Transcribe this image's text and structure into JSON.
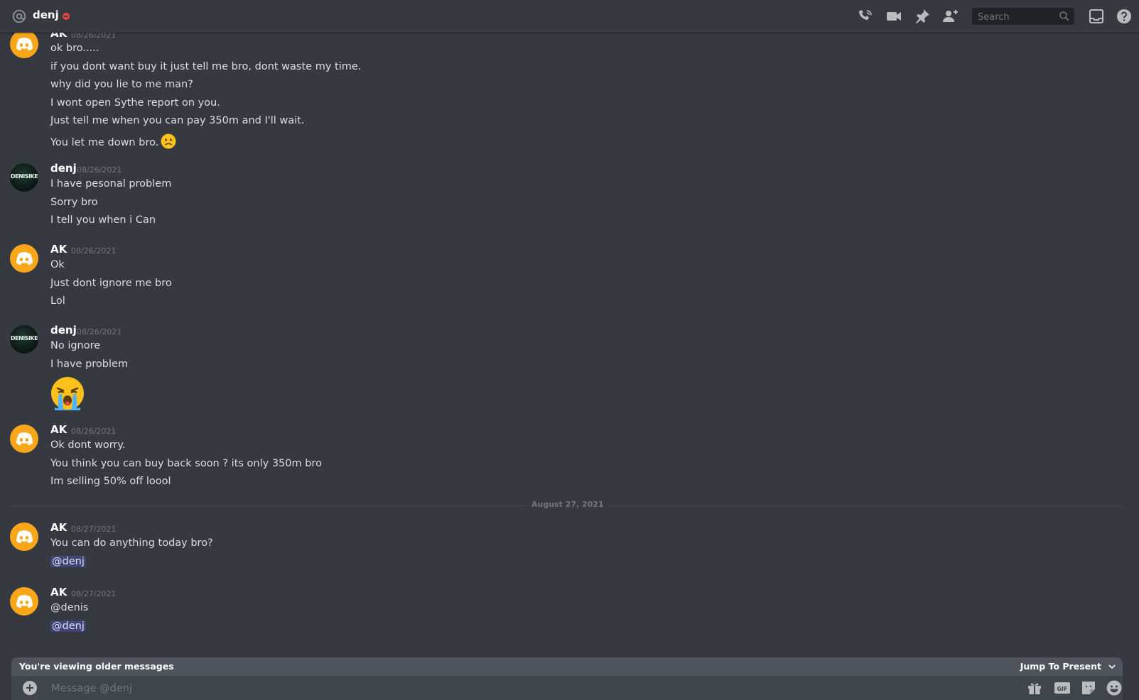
{
  "header": {
    "channel_type_icon": "at-sign-icon",
    "title": "denj",
    "status": "do-not-disturb",
    "search_placeholder": "Search",
    "icons": [
      "call-icon",
      "video-icon",
      "pin-icon",
      "add-friend-icon",
      "search-icon",
      "inbox-icon",
      "help-icon"
    ]
  },
  "messages": {
    "groups": [
      {
        "author": "AK",
        "timestamp": "08/26/2021",
        "avatar": "discord-default-orange",
        "lines": [
          "ok bro.....",
          "if you dont want buy it just tell me bro, dont waste my time.",
          "why did you lie to me man?",
          "I wont open Sythe report on you.",
          "Just tell me when you can pay 350m and I'll wait.",
          "You let me down bro."
        ]
      },
      {
        "author": "denj",
        "timestamp": "08/26/2021",
        "avatar": "DENISIKE",
        "lines": [
          "I have pesonal problem",
          "Sorry bro",
          "I tell you when i Can"
        ]
      },
      {
        "author": "AK",
        "timestamp": "08/26/2021",
        "avatar": "discord-default-orange",
        "lines": [
          "Ok",
          "Just dont ignore me bro",
          "Lol"
        ]
      },
      {
        "author": "denj",
        "timestamp": "08/26/2021",
        "avatar": "DENISIKE",
        "lines": [
          "No ignore",
          "I have problem"
        ]
      },
      {
        "author": "AK",
        "timestamp": "08/26/2021",
        "avatar": "discord-default-orange",
        "lines": [
          "Ok dont worry.",
          "You think you can buy back soon ? its only 350m bro",
          "Im selling 50% off loool"
        ]
      },
      {
        "author": "AK",
        "timestamp": "08/27/2021",
        "avatar": "discord-default-orange",
        "lines": [
          "You can do anything today bro?",
          "@denj"
        ]
      },
      {
        "author": "AK",
        "timestamp": "08/27/2021",
        "avatar": "discord-default-orange",
        "lines": [
          "@denis",
          "@denj"
        ]
      }
    ],
    "date_divider": "August 27, 2021",
    "emojis": [
      "frowning-face-emoji",
      "loudly-crying-face-emoji"
    ]
  },
  "older_bar": {
    "notice": "You're viewing older messages",
    "jump_label": "Jump To Present"
  },
  "composer": {
    "placeholder": "Message @denj",
    "icons": [
      "add-attachment-icon",
      "gift-icon",
      "gif-icon",
      "sticker-icon",
      "emoji-icon"
    ]
  },
  "colors": {
    "background": "#36393f",
    "ak_avatar": "#faa61a",
    "mention_bg": "#4a4f8a",
    "dnd": "#ed4245"
  }
}
